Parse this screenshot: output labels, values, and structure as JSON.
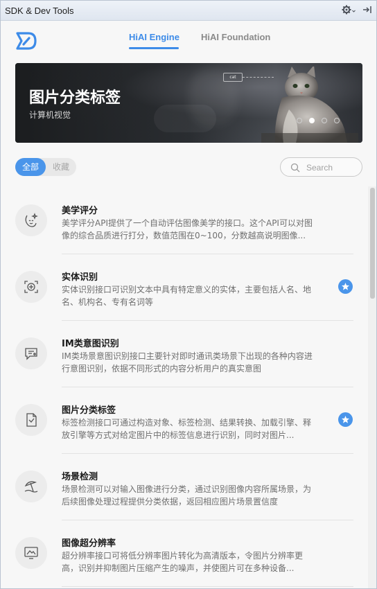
{
  "window": {
    "title": "SDK & Dev Tools"
  },
  "tabs": [
    {
      "label": "HiAI Engine",
      "active": true
    },
    {
      "label": "HiAI Foundation",
      "active": false
    }
  ],
  "banner": {
    "title": "图片分类标签",
    "subtitle": "计算机视觉",
    "image_label": "cat",
    "slides": 4,
    "active_slide": 2
  },
  "filter": {
    "all_label": "全部",
    "favorites_label": "收藏"
  },
  "search": {
    "placeholder": "Search"
  },
  "colors": {
    "accent": "#4a95ea",
    "tab_active": "#3d8be8"
  },
  "items": [
    {
      "name": "美学评分",
      "desc": "美学评分API提供了一个自动评估图像美学的接口。这个API可以对图像的综合品质进行打分，数值范围在0~100，分数越高说明图像...",
      "icon": "face-sparkle-icon",
      "favorited": false
    },
    {
      "name": "实体识别",
      "desc": "实体识别接口可识别文本中具有特定意义的实体，主要包括人名、地名、机构名、专有名词等",
      "icon": "scan-face-icon",
      "favorited": true
    },
    {
      "name": "IM类意图识别",
      "desc": "IM类场景意图识别接口主要针对即时通讯类场景下出现的各种内容进行意图识别，依据不同形式的内容分析用户的真实意图",
      "icon": "chat-bubble-icon",
      "favorited": false
    },
    {
      "name": "图片分类标签",
      "desc": "标签检测接口可通过构造对象、标签检测、结果转换、加载引擎、释放引擎等方式对给定图片中的标签信息进行识别，同时对图片...",
      "icon": "tag-document-icon",
      "favorited": true
    },
    {
      "name": "场景检测",
      "desc": "场景检测可以对输入图像进行分类，通过识别图像内容所属场景，为后续图像处理过程提供分类依据，返回相应图片场景置信度",
      "icon": "beach-umbrella-icon",
      "favorited": false
    },
    {
      "name": "图像超分辨率",
      "desc": "超分辨率接口可将低分辨率图片转化为高清版本，令图片分辨率更高，识别并抑制图片压缩产生的噪声，并使图片可在多种设备...",
      "icon": "monitor-image-icon",
      "favorited": false
    }
  ]
}
